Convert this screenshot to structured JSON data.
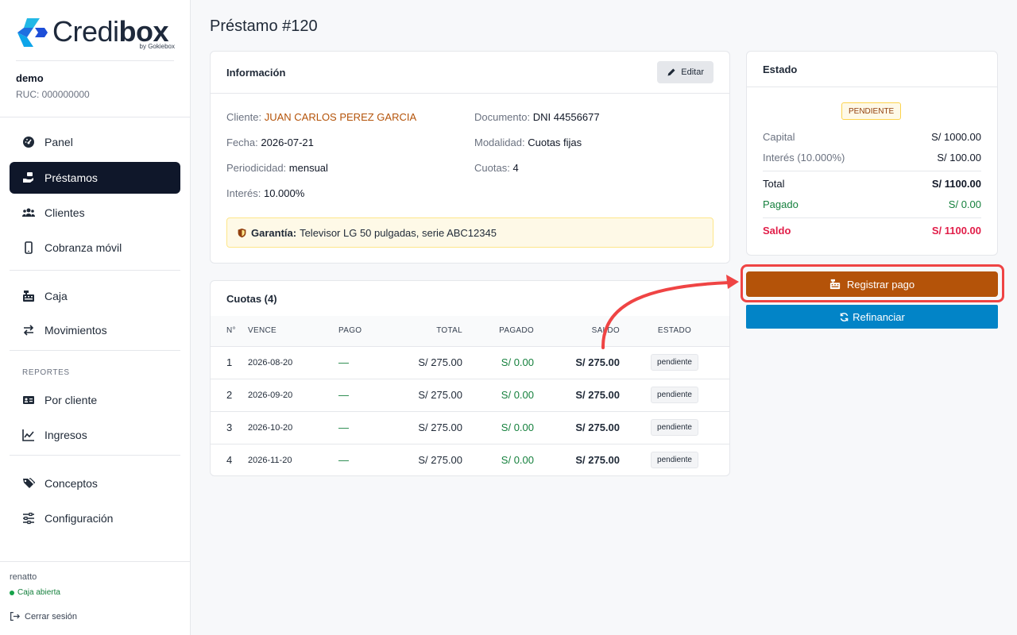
{
  "brand": {
    "name_light": "Credi",
    "name_bold": "box",
    "byline": "by Gokiebox"
  },
  "company": {
    "name": "demo",
    "ruc": "RUC: 000000000"
  },
  "nav": {
    "panel": "Panel",
    "prestamos": "Préstamos",
    "clientes": "Clientes",
    "cobranza": "Cobranza móvil",
    "caja": "Caja",
    "movimientos": "Movimientos",
    "reportes_label": "REPORTES",
    "por_cliente": "Por cliente",
    "ingresos": "Ingresos",
    "conceptos": "Conceptos",
    "configuracion": "Configuración"
  },
  "footer": {
    "user": "renatto",
    "caja_status": "Caja abierta",
    "logout": "Cerrar sesión"
  },
  "page": {
    "title": "Préstamo #120"
  },
  "info": {
    "title": "Información",
    "edit_label": "Editar",
    "cliente_label": "Cliente:",
    "cliente": "JUAN CARLOS PEREZ GARCIA",
    "documento_label": "Documento:",
    "documento": "DNI 44556677",
    "fecha_label": "Fecha:",
    "fecha": "2026-07-21",
    "modalidad_label": "Modalidad:",
    "modalidad": "Cuotas fijas",
    "periodicidad_label": "Periodicidad:",
    "periodicidad": "mensual",
    "cuotas_label": "Cuotas:",
    "cuotas": "4",
    "interes_label": "Interés:",
    "interes": "10.000%",
    "garantia_label": "Garantía:",
    "garantia": "Televisor LG 50 pulgadas, serie ABC12345"
  },
  "cuotas": {
    "title": "Cuotas (4)",
    "headers": [
      "N°",
      "VENCE",
      "PAGO",
      "TOTAL",
      "PAGADO",
      "SALDO",
      "ESTADO"
    ],
    "rows": [
      {
        "n": "1",
        "vence": "2026-08-20",
        "pago": "—",
        "total": "S/ 275.00",
        "pagado": "S/ 0.00",
        "saldo": "S/ 275.00",
        "estado": "pendiente"
      },
      {
        "n": "2",
        "vence": "2026-09-20",
        "pago": "—",
        "total": "S/ 275.00",
        "pagado": "S/ 0.00",
        "saldo": "S/ 275.00",
        "estado": "pendiente"
      },
      {
        "n": "3",
        "vence": "2026-10-20",
        "pago": "—",
        "total": "S/ 275.00",
        "pagado": "S/ 0.00",
        "saldo": "S/ 275.00",
        "estado": "pendiente"
      },
      {
        "n": "4",
        "vence": "2026-11-20",
        "pago": "—",
        "total": "S/ 275.00",
        "pagado": "S/ 0.00",
        "saldo": "S/ 275.00",
        "estado": "pendiente"
      }
    ]
  },
  "estado": {
    "title": "Estado",
    "badge": "PENDIENTE",
    "capital_label": "Capital",
    "capital": "S/ 1000.00",
    "interes_label": "Interés (10.000%)",
    "interes": "S/ 100.00",
    "total_label": "Total",
    "total": "S/ 1100.00",
    "pagado_label": "Pagado",
    "pagado": "S/ 0.00",
    "saldo_label": "Saldo",
    "saldo": "S/ 1100.00"
  },
  "actions": {
    "pay": "Registrar pago",
    "refinance": "Refinanciar"
  },
  "colors": {
    "accent": "#b45309",
    "sidebar_active": "#0f172a",
    "refinance": "#0284c7",
    "highlight": "#ef4444"
  }
}
